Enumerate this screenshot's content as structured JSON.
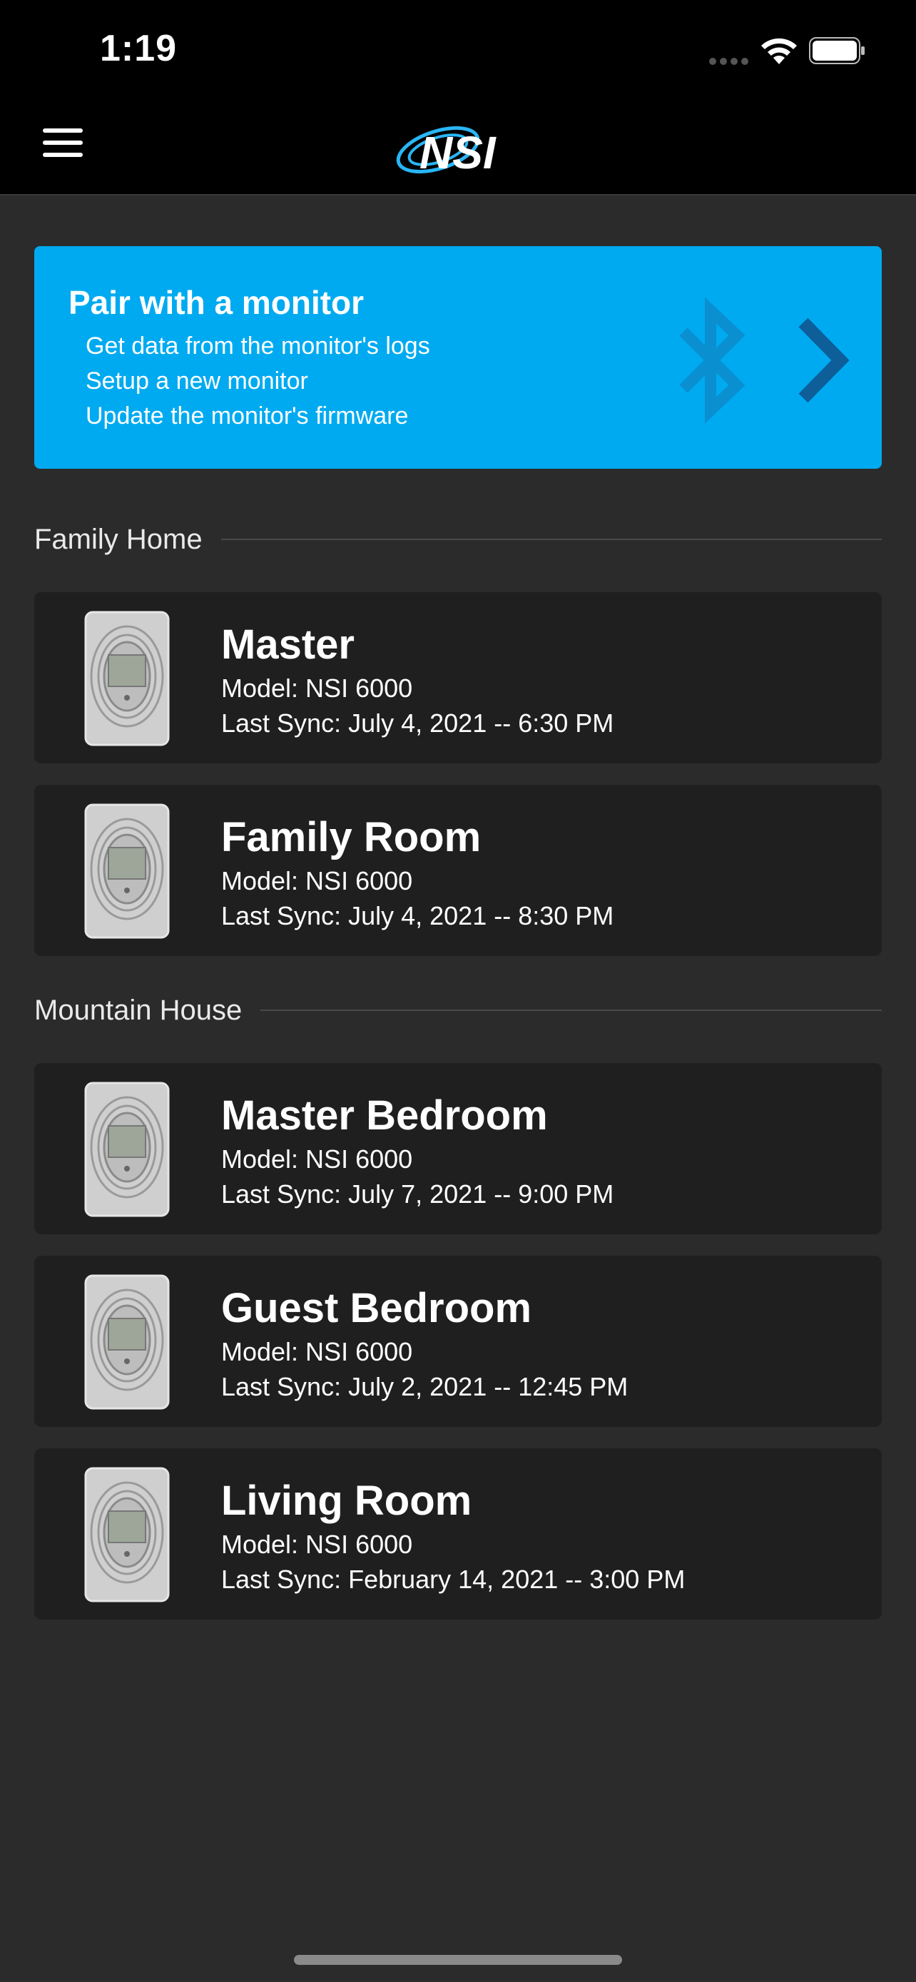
{
  "status_bar": {
    "time": "1:19"
  },
  "app": {
    "logo_text": "NSI"
  },
  "pair_card": {
    "title": "Pair with a monitor",
    "lines": [
      "Get data from the monitor's logs",
      "Setup a new monitor",
      "Update the monitor's firmware"
    ],
    "icon": "bluetooth-icon"
  },
  "groups": [
    {
      "name": "Family Home",
      "devices": [
        {
          "name": "Master",
          "model": "Model: NSI 6000",
          "last_sync": "Last Sync: July 4, 2021 -- 6:30 PM"
        },
        {
          "name": "Family Room",
          "model": "Model: NSI 6000",
          "last_sync": "Last Sync: July 4, 2021 -- 8:30 PM"
        }
      ]
    },
    {
      "name": "Mountain House",
      "devices": [
        {
          "name": "Master Bedroom",
          "model": "Model: NSI 6000",
          "last_sync": "Last Sync: July 7, 2021 -- 9:00 PM"
        },
        {
          "name": "Guest Bedroom",
          "model": "Model: NSI 6000",
          "last_sync": "Last Sync: July 2, 2021 -- 12:45 PM"
        },
        {
          "name": "Living Room",
          "model": "Model: NSI 6000",
          "last_sync": "Last Sync: February 14, 2021 -- 3:00 PM"
        }
      ]
    }
  ],
  "colors": {
    "accent": "#00aaf0",
    "background": "#2b2b2b",
    "card": "#1f1f1f"
  }
}
